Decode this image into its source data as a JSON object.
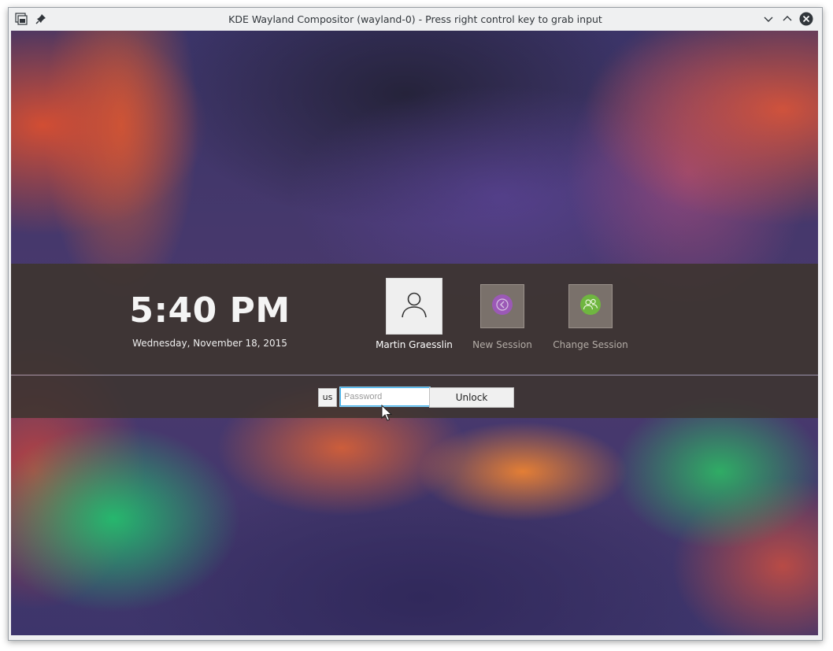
{
  "window": {
    "title": "KDE Wayland Compositor (wayland-0) - Press right control key to grab input",
    "icons": [
      "app-menu-icon",
      "pin-icon",
      "minimize-icon",
      "maximize-icon",
      "close-icon"
    ]
  },
  "lockscreen": {
    "time": "5:40 PM",
    "date": "Wednesday, November 18, 2015",
    "users": [
      {
        "name": "Martin Graesslin",
        "icon": "user-icon",
        "selected": true
      },
      {
        "name": "New Session",
        "icon": "new-session-icon",
        "accent": "#9b59b6"
      },
      {
        "name": "Change Session",
        "icon": "change-session-icon",
        "accent": "#6fb640"
      }
    ],
    "keyboard_layout": "us",
    "password": {
      "value": "",
      "placeholder": "Password"
    },
    "unlock_label": "Unlock"
  },
  "colors": {
    "accent": "#3daee9",
    "titlebar": "#eff0f1"
  }
}
